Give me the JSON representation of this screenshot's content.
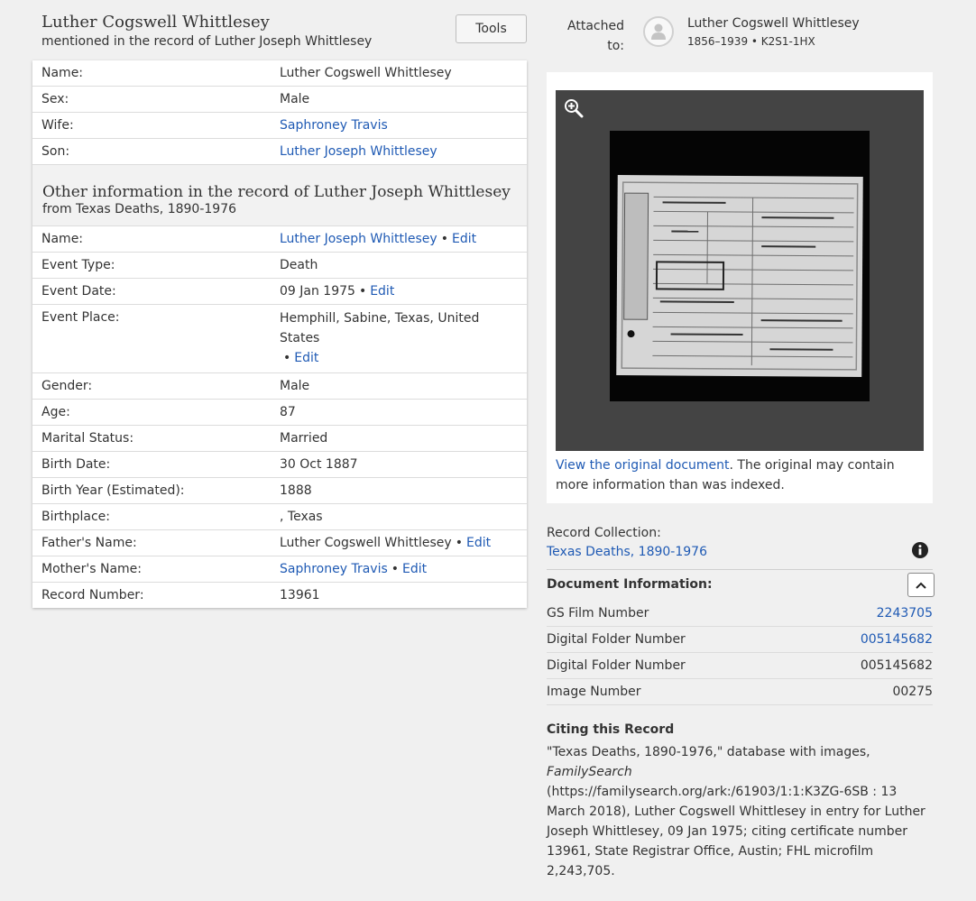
{
  "header": {
    "title": "Luther Cogswell Whittlesey",
    "subtitle": "mentioned in the record of Luther Joseph Whittlesey",
    "tools_label": "Tools"
  },
  "person": {
    "rows": [
      {
        "label": "Name:",
        "value": "Luther Cogswell Whittlesey",
        "link": false
      },
      {
        "label": "Sex:",
        "value": "Male",
        "link": false
      },
      {
        "label": "Wife:",
        "value": "Saphroney Travis",
        "link": true
      },
      {
        "label": "Son:",
        "value": "Luther Joseph Whittlesey",
        "link": true
      }
    ]
  },
  "other": {
    "title": "Other information in the record of Luther Joseph Whittlesey",
    "source": "from Texas Deaths, 1890-1976",
    "edit_label": "Edit",
    "bullet": "•",
    "rows": [
      {
        "label": "Name:",
        "value": "Luther Joseph Whittlesey"
      },
      {
        "label": "Event Type:",
        "value": "Death"
      },
      {
        "label": "Event Date:",
        "value": "09 Jan 1975"
      },
      {
        "label": "Event Place:",
        "value": "Hemphill, Sabine, Texas, United States"
      },
      {
        "label": "Gender:",
        "value": "Male"
      },
      {
        "label": "Age:",
        "value": "87"
      },
      {
        "label": "Marital Status:",
        "value": "Married"
      },
      {
        "label": "Birth Date:",
        "value": "30 Oct 1887"
      },
      {
        "label": "Birth Year (Estimated):",
        "value": "1888"
      },
      {
        "label": "Birthplace:",
        "value": ", Texas"
      },
      {
        "label": "Father's Name:",
        "value": "Luther Cogswell Whittlesey"
      },
      {
        "label": "Mother's Name:",
        "value": "Saphroney Travis"
      },
      {
        "label": "Record Number:",
        "value": "13961"
      }
    ]
  },
  "attached": {
    "label": "Attached to:",
    "name": "Luther Cogswell Whittlesey",
    "meta": "1856–1939 • K2S1-1HX"
  },
  "document": {
    "view_link": "View the original document",
    "caption_rest": ". The original may contain more information than was indexed."
  },
  "collection": {
    "label": "Record Collection:",
    "link": "Texas Deaths, 1890-1976"
  },
  "doc_info": {
    "title": "Document Information:",
    "rows": [
      {
        "label": "GS Film Number",
        "value": "2243705",
        "link": true
      },
      {
        "label": "Digital Folder Number",
        "value": "005145682",
        "link": true
      },
      {
        "label": "Digital Folder Number",
        "value": "005145682",
        "link": false
      },
      {
        "label": "Image Number",
        "value": "00275",
        "link": false
      }
    ]
  },
  "citation": {
    "title": "Citing this Record",
    "part1": "\"Texas Deaths, 1890-1976,\" database with images, ",
    "italic": "FamilySearch",
    "part2": " (https://familysearch.org/ark:/61903/1:1:K3ZG-6SB : 13 March 2018), Luther Cogswell Whittlesey in entry for Luther Joseph Whittlesey, 09 Jan 1975; citing certificate number 13961, State Registrar Office, Austin; FHL microfilm 2,243,705."
  },
  "colors": {
    "link": "#1f5ab4",
    "background": "#f0f0f0"
  }
}
